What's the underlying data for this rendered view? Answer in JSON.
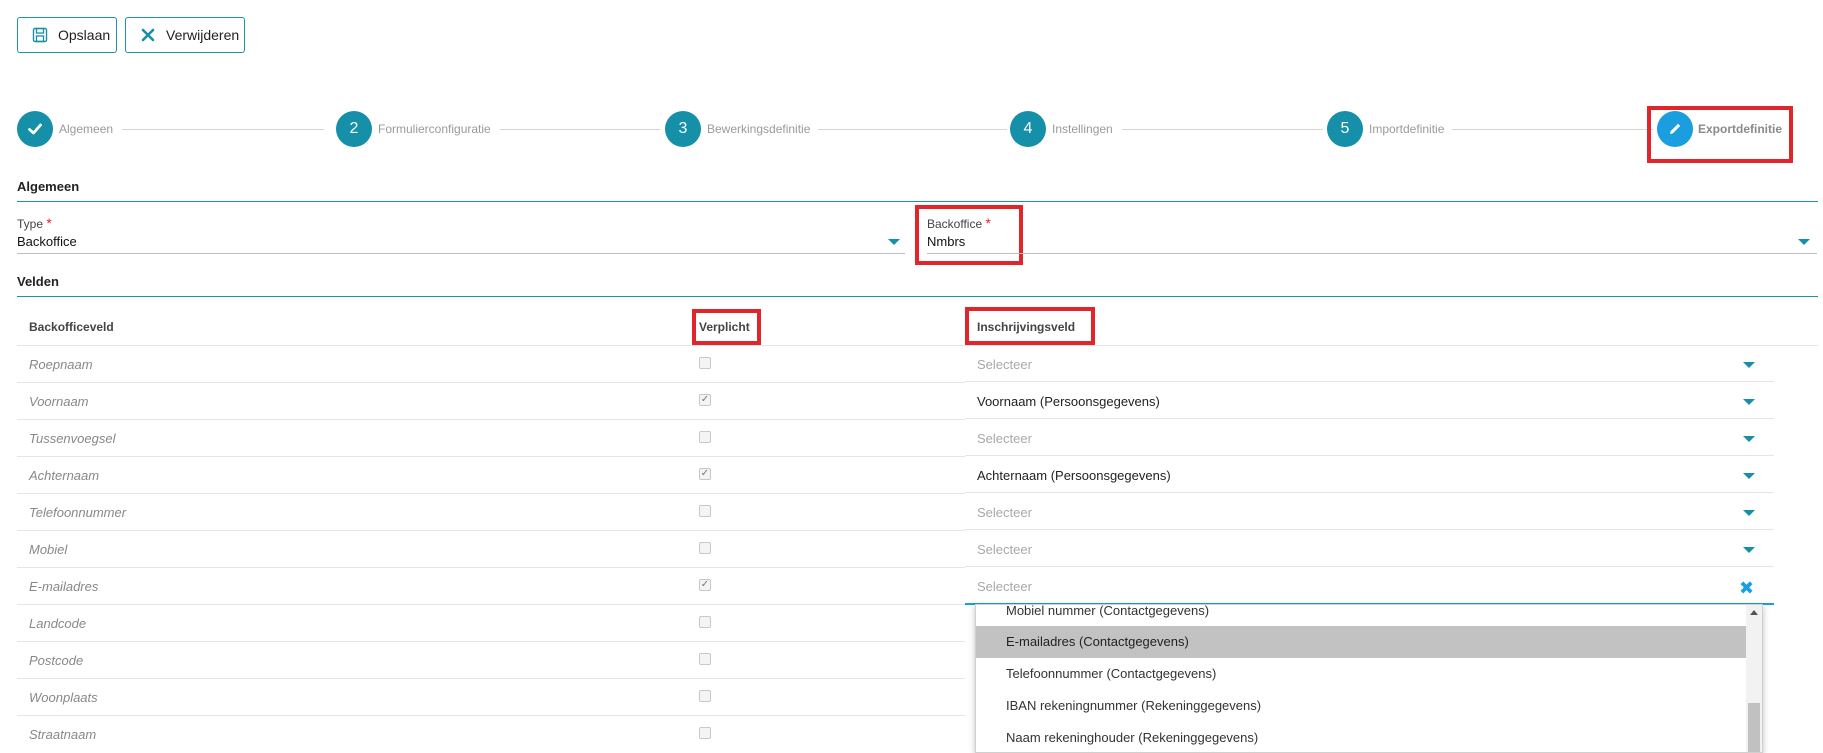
{
  "toolbar": {
    "save_label": "Opslaan",
    "delete_label": "Verwijderen"
  },
  "steps": [
    {
      "number": "",
      "label": "Algemeen",
      "state": "done"
    },
    {
      "number": "2",
      "label": "Formulierconfiguratie",
      "state": "todo"
    },
    {
      "number": "3",
      "label": "Bewerkingsdefinitie",
      "state": "todo"
    },
    {
      "number": "4",
      "label": "Instellingen",
      "state": "todo"
    },
    {
      "number": "5",
      "label": "Importdefinitie",
      "state": "todo"
    },
    {
      "number": "",
      "label": "Exportdefinitie",
      "state": "active"
    }
  ],
  "general": {
    "title": "Algemeen",
    "type_label": "Type",
    "type_value": "Backoffice",
    "backoffice_label": "Backoffice",
    "backoffice_value": "Nmbrs",
    "required_mark": "*"
  },
  "fields": {
    "title": "Velden",
    "col_backoffice": "Backofficeveld",
    "col_required": "Verplicht",
    "col_registration": "Inschrijvingsveld",
    "rows": [
      {
        "name": "Roepnaam",
        "required": false,
        "value": "Selecteer",
        "is_placeholder": true
      },
      {
        "name": "Voornaam",
        "required": true,
        "value": "Voornaam (Persoonsgegevens)",
        "is_placeholder": false
      },
      {
        "name": "Tussenvoegsel",
        "required": false,
        "value": "Selecteer",
        "is_placeholder": true
      },
      {
        "name": "Achternaam",
        "required": true,
        "value": "Achternaam (Persoonsgegevens)",
        "is_placeholder": false
      },
      {
        "name": "Telefoonnummer",
        "required": false,
        "value": "Selecteer",
        "is_placeholder": true
      },
      {
        "name": "Mobiel",
        "required": false,
        "value": "Selecteer",
        "is_placeholder": true
      },
      {
        "name": "E-mailadres",
        "required": true,
        "value": "Selecteer",
        "is_placeholder": true
      },
      {
        "name": "Landcode",
        "required": false,
        "value": "",
        "is_placeholder": true
      },
      {
        "name": "Postcode",
        "required": false,
        "value": "",
        "is_placeholder": true
      },
      {
        "name": "Woonplaats",
        "required": false,
        "value": "",
        "is_placeholder": true
      },
      {
        "name": "Straatnaam",
        "required": false,
        "value": "",
        "is_placeholder": true
      }
    ]
  },
  "dropdown": {
    "options": [
      "Mobiel nummer (Contactgegevens)",
      "E-mailadres (Contactgegevens)",
      "Telefoonnummer (Contactgegevens)",
      "IBAN rekeningnummer (Rekeninggegevens)",
      "Naam rekeninghouder (Rekeninggegevens)"
    ],
    "highlighted": "E-mailadres (Contactgegevens)"
  },
  "colors": {
    "accent": "#1590a8",
    "active_step": "#1a9ee0",
    "highlight_box": "#e0252b"
  }
}
